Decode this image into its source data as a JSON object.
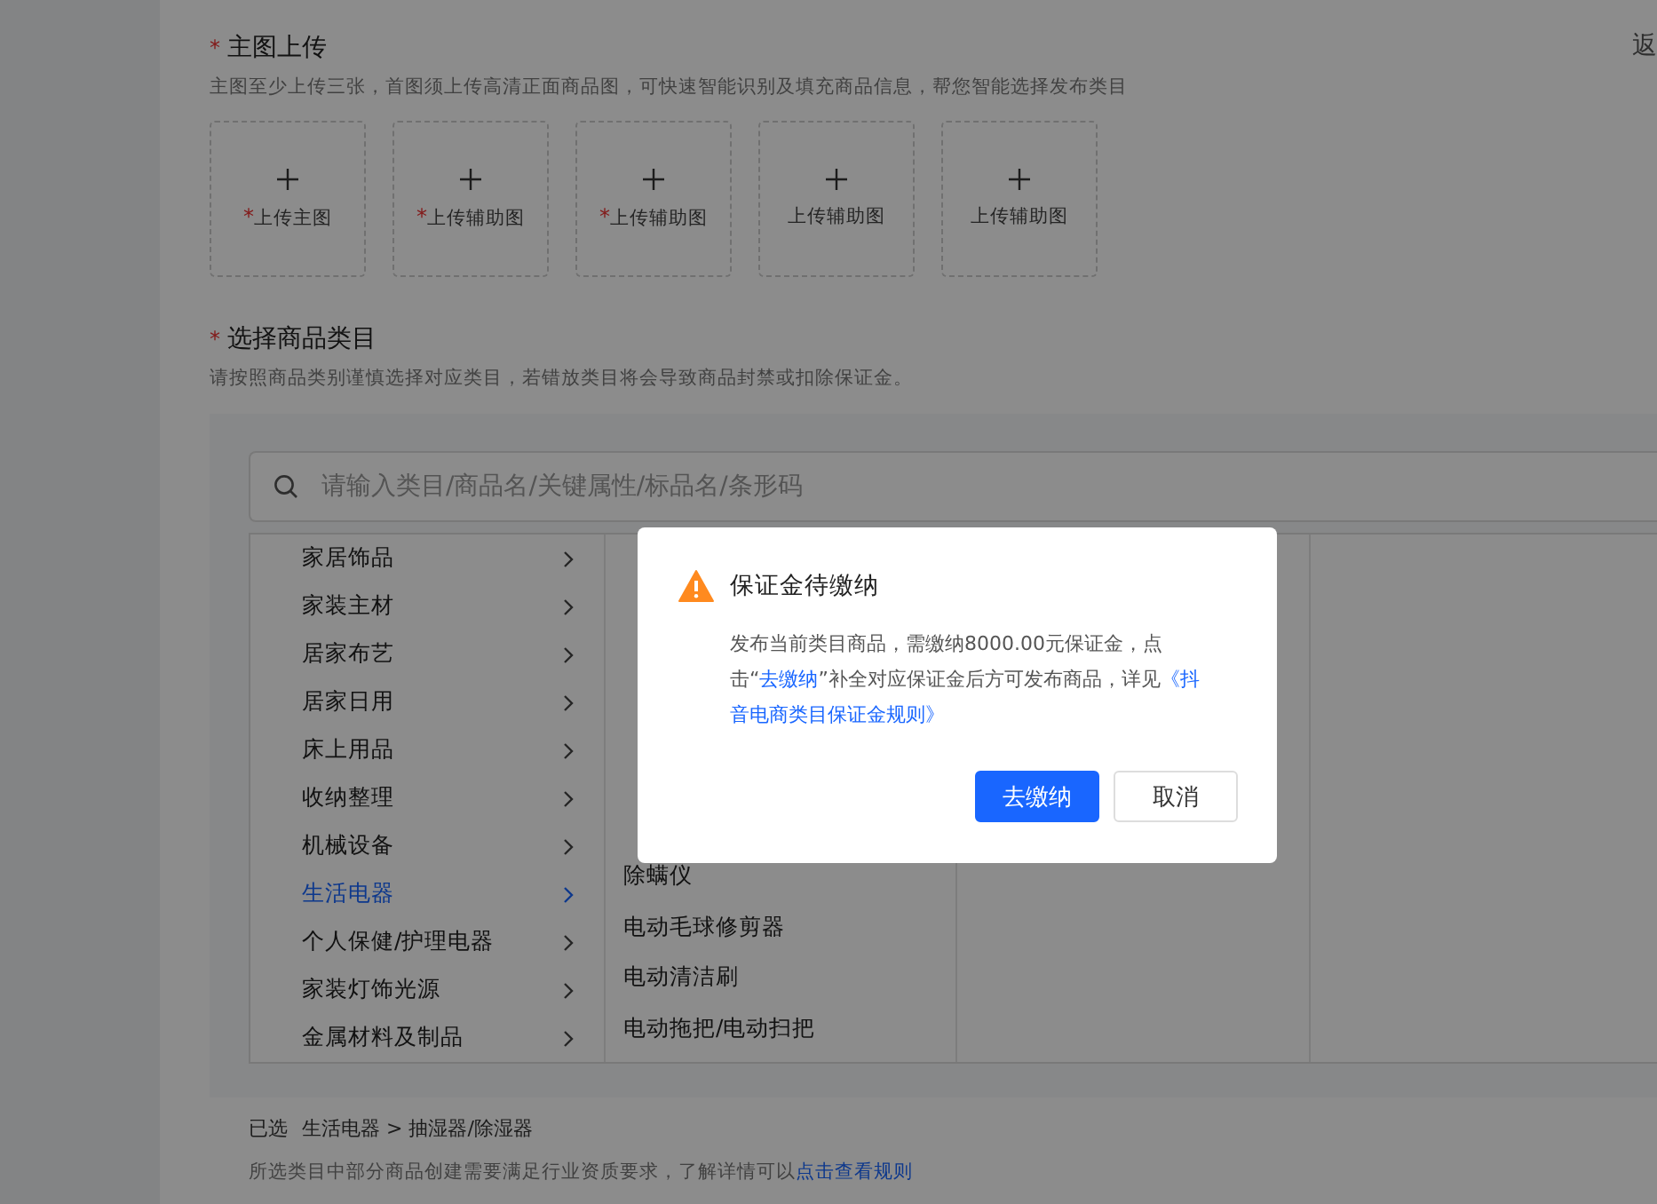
{
  "back_link": "返",
  "required_mark": "*",
  "upload": {
    "title": "主图上传",
    "hint": "主图至少上传三张，首图须上传高清正面商品图，可快速智能识别及填充商品信息，帮您智能选择发布类目",
    "slots": [
      {
        "label": "上传主图",
        "required": true
      },
      {
        "label": "上传辅助图",
        "required": true
      },
      {
        "label": "上传辅助图",
        "required": true
      },
      {
        "label": "上传辅助图",
        "required": false
      },
      {
        "label": "上传辅助图",
        "required": false
      }
    ]
  },
  "category": {
    "title": "选择商品类目",
    "hint": "请按照商品类别谨慎选择对应类目，若错放类目将会导致商品封禁或扣除保证金。",
    "search": {
      "placeholder": "请输入类目/商品名/关键属性/标品名/条形码"
    },
    "level1": [
      {
        "label": "家居饰品",
        "selected": false
      },
      {
        "label": "家装主材",
        "selected": false
      },
      {
        "label": "居家布艺",
        "selected": false
      },
      {
        "label": "居家日用",
        "selected": false
      },
      {
        "label": "床上用品",
        "selected": false
      },
      {
        "label": "收纳整理",
        "selected": false
      },
      {
        "label": "机械设备",
        "selected": false
      },
      {
        "label": "生活电器",
        "selected": true
      },
      {
        "label": "个人保健/护理电器",
        "selected": false
      },
      {
        "label": "家装灯饰光源",
        "selected": false
      },
      {
        "label": "金属材料及制品",
        "selected": false
      }
    ],
    "level2": [
      {
        "label": "除螨仪",
        "selected": false
      },
      {
        "label": "电动毛球修剪器",
        "selected": false
      },
      {
        "label": "电动清洁刷",
        "selected": false
      },
      {
        "label": "电动拖把/电动扫把",
        "selected": false
      }
    ],
    "selected_label": "已选",
    "selected_path": "生活电器 > 抽湿器/除湿器",
    "notice": "所选类目中部分商品创建需要满足行业资质要求，了解详情可以",
    "notice_link": "点击查看规则"
  },
  "dialog": {
    "title": "保证金待缴纳",
    "body_start": "发布当前类目商品，需缴纳8000.00元保证金，点击",
    "quote_open": "“",
    "body_link": "去缴纳",
    "quote_close": "”",
    "body_mid": "补全对应保证金后方可发布商品，详见",
    "rules_link_parts": [
      "《抖",
      "音电商类目保证金规则》"
    ],
    "buttons": [
      {
        "label": "去缴纳",
        "kind": "primary"
      },
      {
        "label": "取消",
        "kind": "secondary"
      }
    ]
  }
}
